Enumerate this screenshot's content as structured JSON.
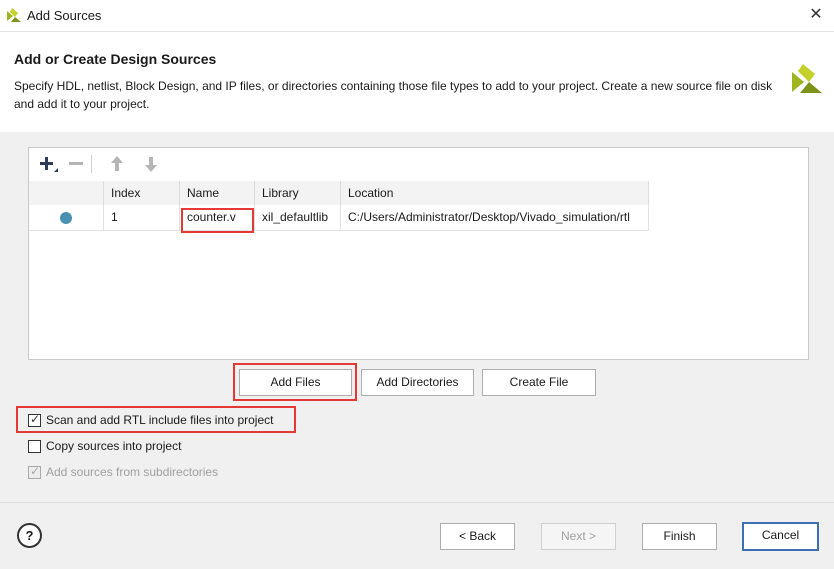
{
  "window": {
    "title": "Add Sources",
    "close_glyph": "✕"
  },
  "header": {
    "title": "Add or Create Design Sources",
    "description": "Specify HDL, netlist, Block Design, and IP files, or directories containing those file types to add to your project. Create a new source file on disk and add it to your project."
  },
  "toolbar": {
    "icons": [
      "add-icon",
      "remove-icon",
      "move-up-icon",
      "move-down-icon"
    ]
  },
  "table": {
    "columns": [
      "",
      "Index",
      "Name",
      "Library",
      "Location"
    ],
    "rows": [
      {
        "status": "included",
        "index": "1",
        "name": "counter.v",
        "library": "xil_defaultlib",
        "location": "C:/Users/Administrator/Desktop/Vivado_simulation/rtl"
      }
    ]
  },
  "actions": {
    "add_files": "Add Files",
    "add_directories": "Add Directories",
    "create_file": "Create File"
  },
  "options": {
    "scan_rtl": {
      "label": "Scan and add RTL include files into project",
      "checked": true
    },
    "copy_sources": {
      "label": "Copy sources into project",
      "checked": false
    },
    "add_subdirs": {
      "label": "Add sources from subdirectories",
      "checked": true,
      "disabled": true
    }
  },
  "footer": {
    "help": "?",
    "back": "< Back",
    "next": "Next >",
    "finish": "Finish",
    "cancel": "Cancel"
  },
  "colors": {
    "highlight": "#e53935",
    "primary_border": "#3d6fb4",
    "status_dot": "#4a90b0",
    "logo": "#9fb520"
  }
}
